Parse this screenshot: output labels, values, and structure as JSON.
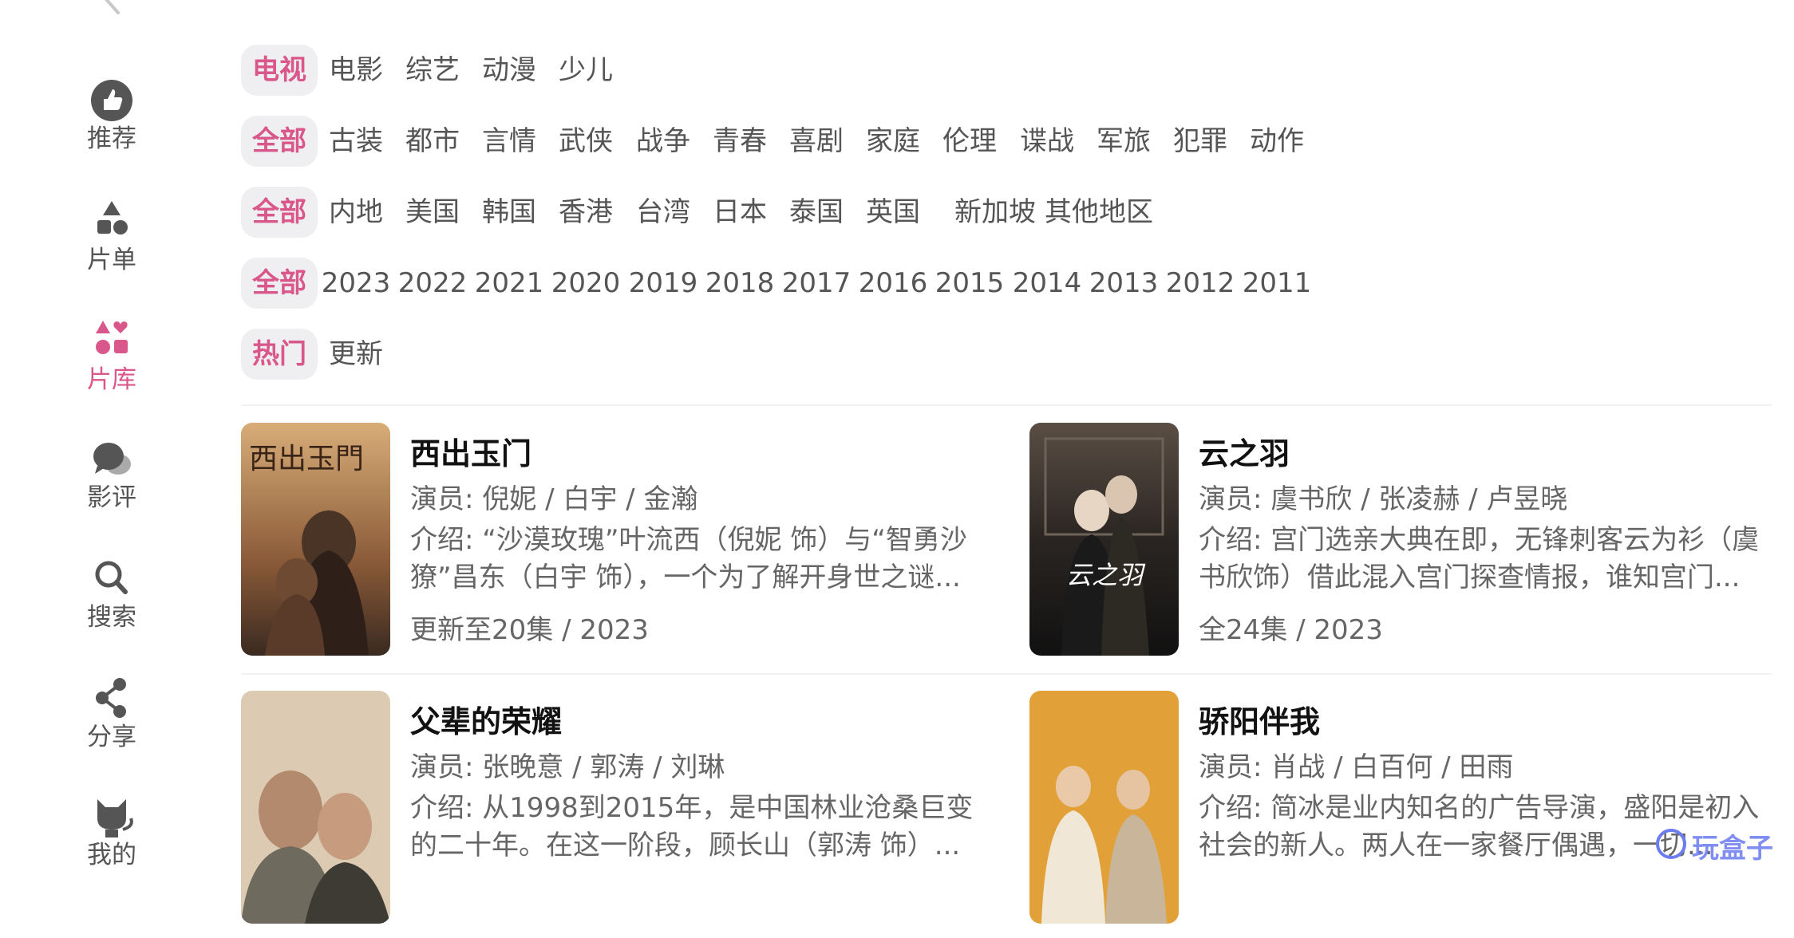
{
  "sidebar": {
    "items": [
      {
        "label": "推荐",
        "icon": "thumbs-up-icon"
      },
      {
        "label": "片单",
        "icon": "shapes-icon"
      },
      {
        "label": "片库",
        "icon": "library-icon"
      },
      {
        "label": "影评",
        "icon": "chat-bubbles-icon"
      },
      {
        "label": "搜索",
        "icon": "search-icon"
      },
      {
        "label": "分享",
        "icon": "share-icon"
      },
      {
        "label": "我的",
        "icon": "cat-icon"
      }
    ],
    "active": "片库"
  },
  "filters": {
    "category": {
      "options": [
        "电视",
        "电影",
        "综艺",
        "动漫",
        "少儿"
      ],
      "selected": "电视"
    },
    "genre": {
      "options": [
        "全部",
        "古装",
        "都市",
        "言情",
        "武侠",
        "战争",
        "青春",
        "喜剧",
        "家庭",
        "伦理",
        "谍战",
        "军旅",
        "犯罪",
        "动作"
      ],
      "selected": "全部"
    },
    "region": {
      "options": [
        "全部",
        "内地",
        "美国",
        "韩国",
        "香港",
        "台湾",
        "日本",
        "泰国",
        "英国",
        "新加坡",
        "其他地区"
      ],
      "selected": "全部"
    },
    "year": {
      "options": [
        "全部",
        "2023",
        "2022",
        "2021",
        "2020",
        "2019",
        "2018",
        "2017",
        "2016",
        "2015",
        "2014",
        "2013",
        "2012",
        "2011"
      ],
      "selected": "全部"
    },
    "sort": {
      "options": [
        "热门",
        "更新"
      ],
      "selected": "热门"
    }
  },
  "shows": [
    {
      "title": "西出玉门",
      "cast": "演员: 倪妮 / 白宇 / 金瀚",
      "intro": "介绍: “沙漠玫瑰”叶流西（倪妮 饰）与“智勇沙獠”昌东（白宇 饰），一个为了解开身世之谜...",
      "meta": "更新至20集 / 2023",
      "poster_text": "西出玉門",
      "poster_colors": [
        "#c89a66",
        "#8a5a38",
        "#3a2a20"
      ]
    },
    {
      "title": "云之羽",
      "cast": "演员: 虞书欣 / 张凌赫 / 卢昱晓",
      "intro": "介绍: 宫门选亲大典在即，无锋刺客云为衫（虞书欣饰）借此混入宫门探查情报，谁知宫门...",
      "meta": "全24集 / 2023",
      "poster_text": "云之羽",
      "poster_colors": [
        "#4a4038",
        "#2a2522",
        "#111111"
      ]
    },
    {
      "title": "父辈的荣耀",
      "cast": "演员: 张晚意 / 郭涛 / 刘琳",
      "intro": "介绍: 从1998到2015年，是中国林业沧桑巨变的二十年。在这一阶段，顾长山（郭涛 饰）...",
      "meta": "",
      "poster_text": "",
      "poster_colors": [
        "#d9c8b0",
        "#b8a58a",
        "#6f6a5e"
      ]
    },
    {
      "title": "骄阳伴我",
      "cast": "演员: 肖战 / 白百何 / 田雨",
      "intro": "介绍: 简冰是业内知名的广告导演，盛阳是初入社会的新人。两人在一家餐厅偶遇，一切...",
      "meta": "",
      "poster_text": "",
      "poster_colors": [
        "#e8a63a",
        "#c97f24",
        "#f0d9b8"
      ]
    }
  ],
  "watermark": "玩盒子"
}
